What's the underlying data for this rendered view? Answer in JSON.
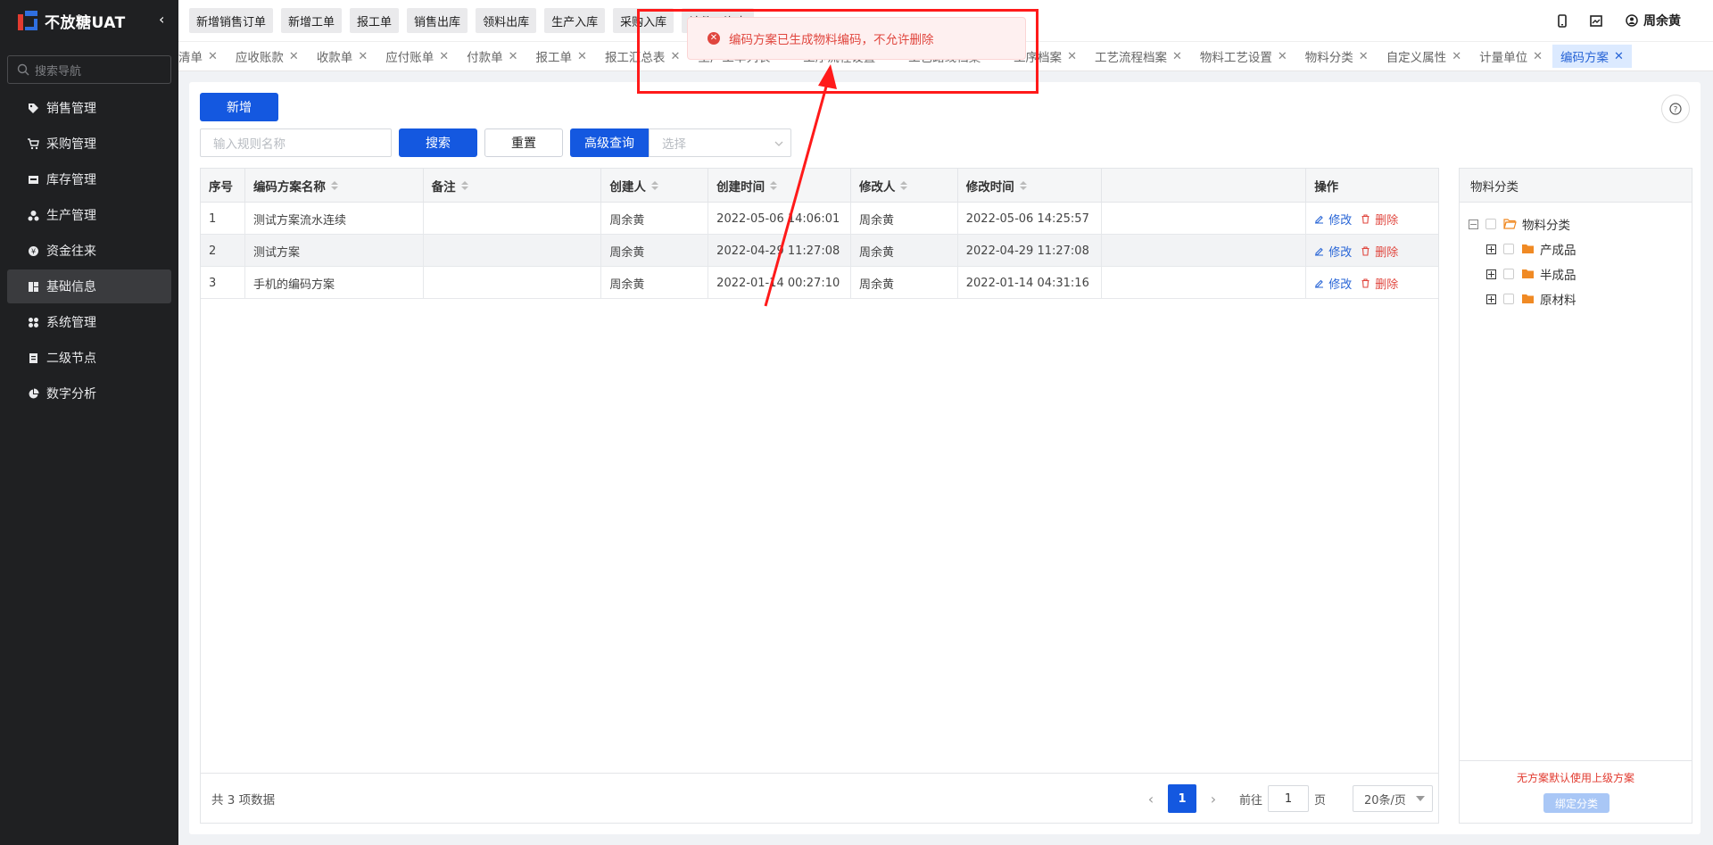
{
  "app": {
    "name": "不放糖UAT"
  },
  "sidebar": {
    "search_placeholder": "搜索导航",
    "items": [
      {
        "label": "销售管理",
        "icon": "tag-icon"
      },
      {
        "label": "采购管理",
        "icon": "cart-icon"
      },
      {
        "label": "库存管理",
        "icon": "inbox-icon"
      },
      {
        "label": "生产管理",
        "icon": "factory-icon"
      },
      {
        "label": "资金往来",
        "icon": "money-icon"
      },
      {
        "label": "基础信息",
        "icon": "grid-icon",
        "active": true
      },
      {
        "label": "系统管理",
        "icon": "apps-icon"
      },
      {
        "label": "二级节点",
        "icon": "document-icon"
      },
      {
        "label": "数字分析",
        "icon": "pie-chart-icon"
      }
    ]
  },
  "topbar": {
    "quick_buttons": [
      "新增销售订单",
      "新增工单",
      "报工单",
      "销售出库",
      "领料出库",
      "生产入库",
      "采购入库",
      "计件工资表"
    ],
    "user": "周余黄"
  },
  "tabs": [
    {
      "label": "清单"
    },
    {
      "label": "应收账款"
    },
    {
      "label": "收款单"
    },
    {
      "label": "应付账单"
    },
    {
      "label": "付款单"
    },
    {
      "label": "报工单"
    },
    {
      "label": "报工汇总表"
    },
    {
      "label": "生产工单列表"
    },
    {
      "label": "工序流程设置"
    },
    {
      "label": "工艺路线档案"
    },
    {
      "label": "工序档案"
    },
    {
      "label": "工艺流程档案"
    },
    {
      "label": "物料工艺设置"
    },
    {
      "label": "物料分类"
    },
    {
      "label": "自定义属性"
    },
    {
      "label": "计量单位"
    },
    {
      "label": "编码方案",
      "active": true
    }
  ],
  "toolbar": {
    "add_label": "新增",
    "search_placeholder": "输入规则名称",
    "search_label": "搜索",
    "reset_label": "重置",
    "advanced_label": "高级查询",
    "select_placeholder": "选择"
  },
  "table": {
    "headers": [
      "序号",
      "编码方案名称",
      "备注",
      "创建人",
      "创建时间",
      "修改人",
      "修改时间",
      "",
      "操作"
    ],
    "rows": [
      {
        "no": "1",
        "name": "测试方案流水连续",
        "remark": "",
        "creator": "周余黄",
        "created": "2022-05-06 14:06:01",
        "modifier": "周余黄",
        "modified": "2022-05-06 14:25:57"
      },
      {
        "no": "2",
        "name": "测试方案",
        "remark": "",
        "creator": "周余黄",
        "created": "2022-04-29 11:27:08",
        "modifier": "周余黄",
        "modified": "2022-04-29 11:27:08"
      },
      {
        "no": "3",
        "name": "手机的编码方案",
        "remark": "",
        "creator": "周余黄",
        "created": "2022-01-14 00:27:10",
        "modifier": "周余黄",
        "modified": "2022-01-14 04:31:16"
      }
    ],
    "edit_label": "修改",
    "delete_label": "删除"
  },
  "pagination": {
    "total_text": "共 3 项数据",
    "current_page": "1",
    "goto_prefix": "前往",
    "goto_value": "1",
    "goto_suffix": "页",
    "page_size": "20条/页"
  },
  "tree": {
    "title": "物料分类",
    "root": "物料分类",
    "children": [
      "产成品",
      "半成品",
      "原材料"
    ],
    "hint": "无方案默认使用上级方案",
    "bind_label": "绑定分类"
  },
  "toast": {
    "message": "编码方案已生成物料编码，不允许删除",
    "type": "error"
  },
  "colors": {
    "primary": "#1458e0",
    "danger": "#e0463e",
    "annotation": "#ff1a1a",
    "sidebar": "#1f2022"
  }
}
